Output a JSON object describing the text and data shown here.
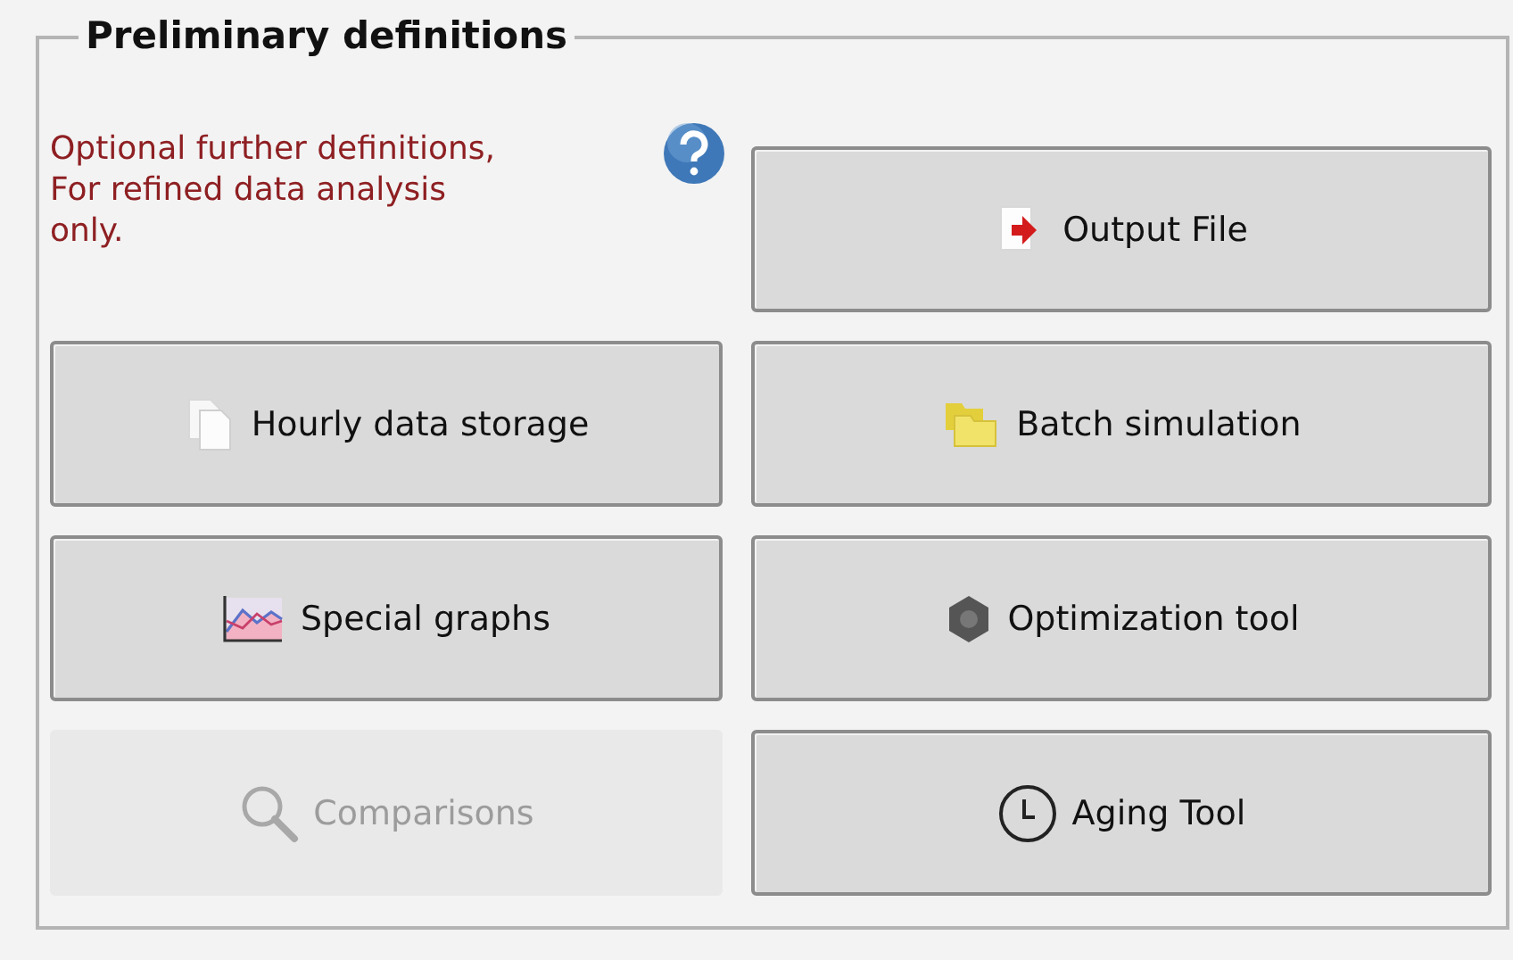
{
  "group": {
    "title": "Preliminary definitions"
  },
  "note": {
    "text": "Optional further definitions, For refined data analysis only."
  },
  "buttons": [
    {
      "label": "Output File",
      "kind": "export",
      "disabled": false
    },
    {
      "label": "Hourly data storage",
      "kind": "pages",
      "disabled": false
    },
    {
      "label": "Batch simulation",
      "kind": "folders",
      "disabled": false
    },
    {
      "label": "Special graphs",
      "kind": "chart",
      "disabled": false
    },
    {
      "label": "Optimization tool",
      "kind": "gear",
      "disabled": false
    },
    {
      "label": "Comparisons",
      "kind": "search",
      "disabled": true
    },
    {
      "label": "Aging Tool",
      "kind": "clock",
      "disabled": false
    }
  ]
}
